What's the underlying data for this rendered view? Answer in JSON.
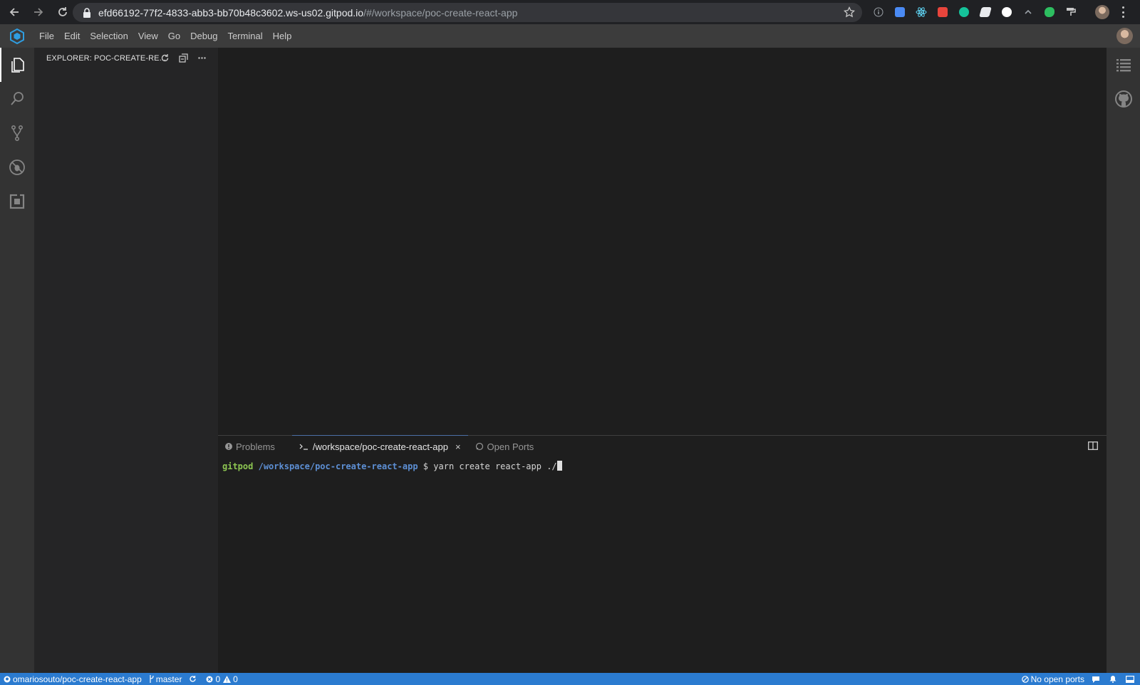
{
  "browser": {
    "url_host": "efd66192-77f2-4833-abb3-bb70b48c3602.ws-us02.gitpod.io",
    "url_path": "/#/workspace/poc-create-react-app",
    "extensions": [
      {
        "icon": "info-icon",
        "color": "#9aa0a6"
      },
      {
        "icon": "google-translate-icon",
        "color": "#4a8af4"
      },
      {
        "icon": "react-devtools-icon",
        "color": "#61dafb"
      },
      {
        "icon": "extension-red-icon",
        "color": "#e8453c"
      },
      {
        "icon": "grammarly-icon",
        "color": "#15c39a"
      },
      {
        "icon": "extension-white-icon",
        "color": "#e8eaed"
      },
      {
        "icon": "extension-circle-icon",
        "color": "#ffffff"
      },
      {
        "icon": "extension-caret-icon",
        "color": "#9aa0a6"
      },
      {
        "icon": "evernote-icon",
        "color": "#2dbe60"
      },
      {
        "icon": "paint-roller-icon",
        "color": "#c8c8c8"
      }
    ]
  },
  "menu": {
    "items": [
      "File",
      "Edit",
      "Selection",
      "View",
      "Go",
      "Debug",
      "Terminal",
      "Help"
    ]
  },
  "sidebar": {
    "title": "EXPLORER: POC-CREATE-RE..."
  },
  "panel": {
    "tabs": {
      "problems": "Problems",
      "terminal": "/workspace/poc-create-react-app",
      "ports": "Open Ports"
    },
    "terminal": {
      "user": "gitpod",
      "path": "/workspace/poc-create-react-app",
      "prompt": "$",
      "command": "yarn create react-app ./"
    }
  },
  "statusbar": {
    "repo": "omariosouto/poc-create-react-app",
    "branch": "master",
    "errors": "0",
    "warnings": "0",
    "ports": "No open ports"
  },
  "colors": {
    "status_bar": "#2b7bd0",
    "terminal_user": "#8ec752",
    "terminal_path": "#5d8fd4"
  }
}
